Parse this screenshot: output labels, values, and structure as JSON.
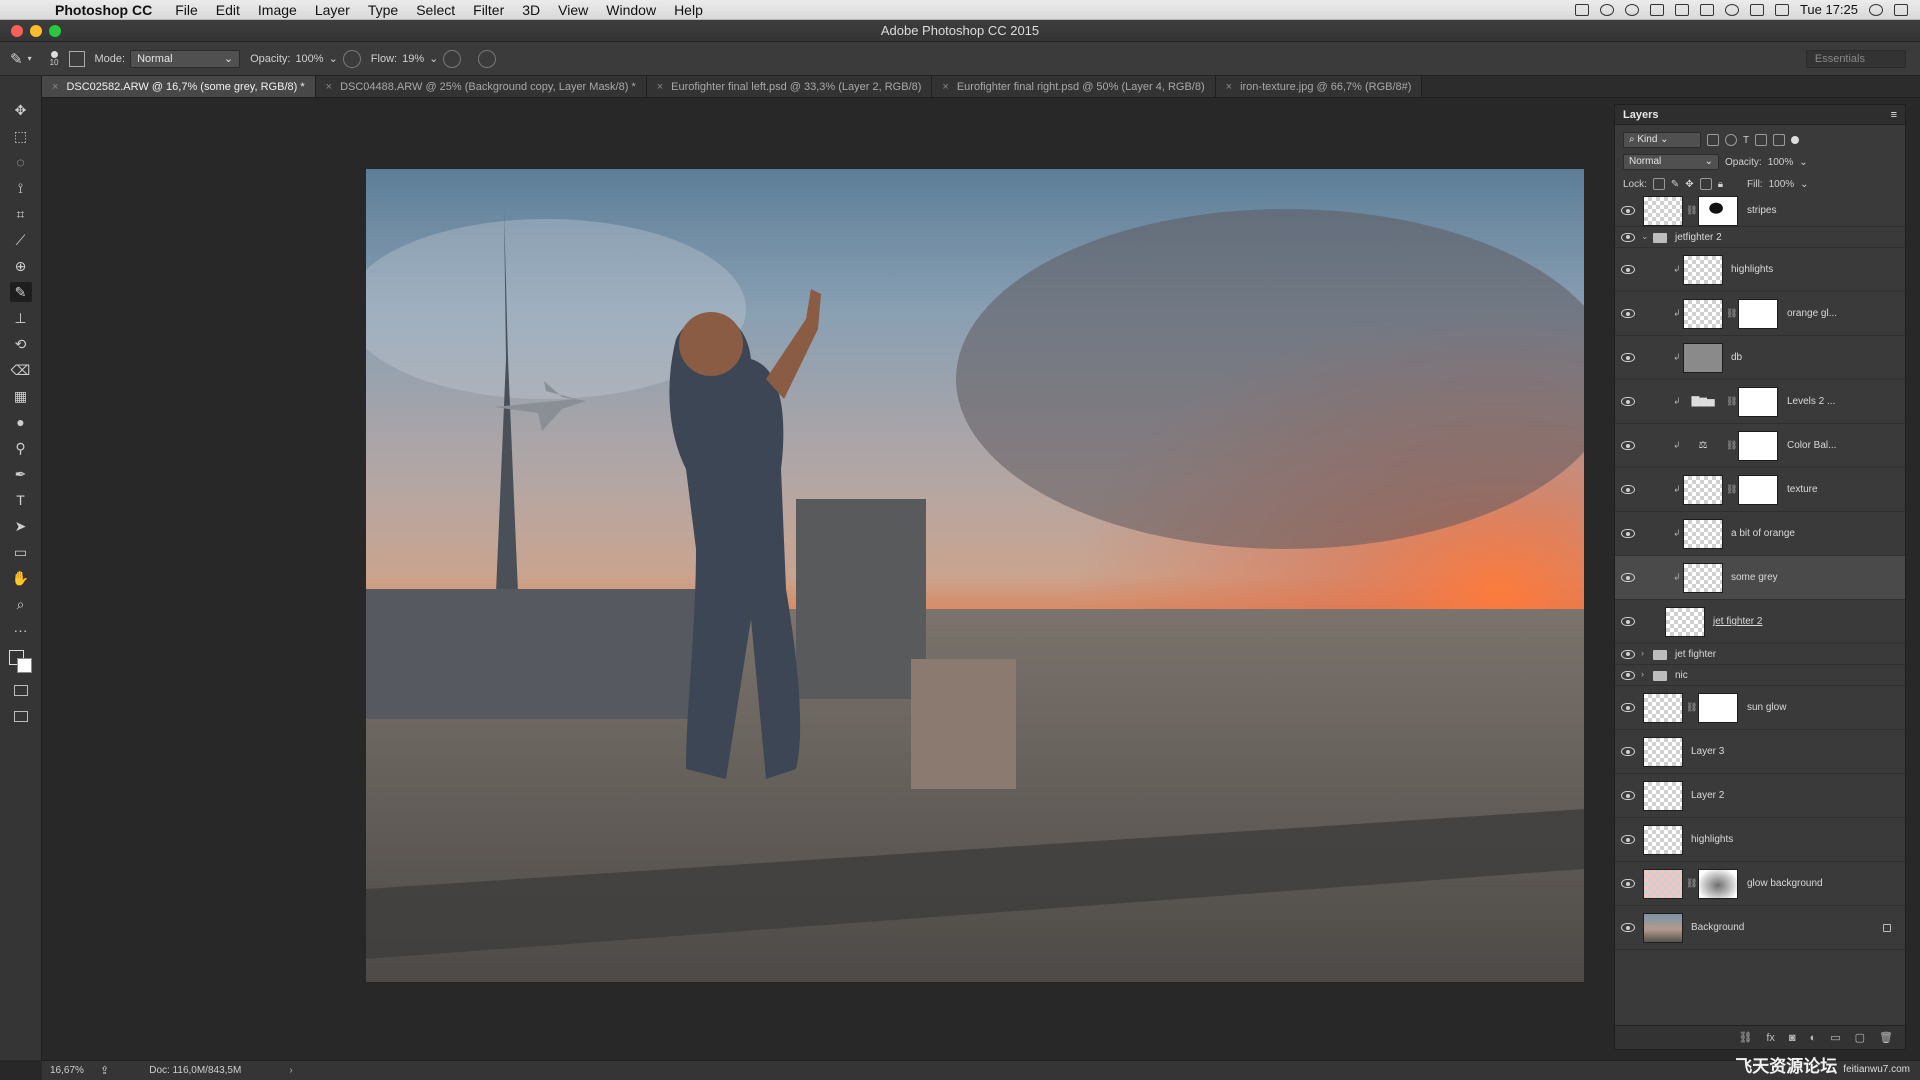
{
  "menubar": {
    "app_name": "Photoshop CC",
    "items": [
      "File",
      "Edit",
      "Image",
      "Layer",
      "Type",
      "Select",
      "Filter",
      "3D",
      "View",
      "Window",
      "Help"
    ],
    "clock": "Tue 17:25"
  },
  "window": {
    "title": "Adobe Photoshop CC 2015"
  },
  "options": {
    "brush_size": "10",
    "mode_label": "Mode:",
    "mode_value": "Normal",
    "opacity_label": "Opacity:",
    "opacity_value": "100%",
    "flow_label": "Flow:",
    "flow_value": "19%",
    "workspace": "Essentials"
  },
  "tabs": [
    {
      "label": "DSC02582.ARW @ 16,7% (some grey, RGB/8) *",
      "active": true
    },
    {
      "label": "DSC04488.ARW @ 25% (Background copy, Layer Mask/8) *",
      "active": false
    },
    {
      "label": "Eurofighter final left.psd @ 33,3% (Layer 2, RGB/8)",
      "active": false
    },
    {
      "label": "Eurofighter final right.psd @ 50% (Layer 4, RGB/8)",
      "active": false
    },
    {
      "label": "iron-texture.jpg @ 66,7% (RGB/8#)",
      "active": false
    }
  ],
  "tools": [
    "move-tool",
    "marquee-tool",
    "lasso-tool",
    "quick-select-tool",
    "crop-tool",
    "eyedropper-tool",
    "healing-tool",
    "brush-tool",
    "stamp-tool",
    "history-brush-tool",
    "eraser-tool",
    "gradient-tool",
    "blur-tool",
    "dodge-tool",
    "pen-tool",
    "type-tool",
    "path-select-tool",
    "shape-tool",
    "hand-tool",
    "zoom-tool",
    "more-tools"
  ],
  "tool_glyphs": [
    "✥",
    "⬚",
    "◌",
    "⟟",
    "⌗",
    "⟋",
    "⊕",
    "✎",
    "⊥",
    "⟲",
    "⌫",
    "▦",
    "●",
    "⚲",
    "✒",
    "T",
    "➤",
    "▭",
    "✋",
    "⌕",
    "···"
  ],
  "colors": {
    "foreground": "#333333",
    "background": "#ffffff",
    "accent": "#4a4a4a"
  },
  "layers_panel": {
    "title": "Layers",
    "filter_kind": "Kind",
    "blend_mode": "Normal",
    "opacity_label": "Opacity:",
    "opacity_value": "100%",
    "lock_label": "Lock:",
    "fill_label": "Fill:",
    "fill_value": "100%",
    "layers": [
      {
        "name": "stripes",
        "indent": 0,
        "kind": "masked",
        "mask": "brush"
      },
      {
        "name": "jetfighter 2",
        "indent": 0,
        "kind": "group",
        "open": true
      },
      {
        "name": "highlights",
        "indent": 1,
        "kind": "pixel",
        "clip": true
      },
      {
        "name": "orange gl...",
        "indent": 1,
        "kind": "masked",
        "clip": true
      },
      {
        "name": "db",
        "indent": 1,
        "kind": "solid",
        "clip": true
      },
      {
        "name": "Levels 2 ...",
        "indent": 1,
        "kind": "adjust",
        "glyph": "levels",
        "clip": true
      },
      {
        "name": "Color Bal...",
        "indent": 1,
        "kind": "adjust",
        "glyph": "balance",
        "clip": true
      },
      {
        "name": "texture",
        "indent": 1,
        "kind": "masked",
        "clip": true
      },
      {
        "name": "a bit of orange",
        "indent": 1,
        "kind": "pixel",
        "clip": true
      },
      {
        "name": "some grey",
        "indent": 1,
        "kind": "pixel",
        "clip": true,
        "selected": true
      },
      {
        "name": "jet fighter 2",
        "indent": 1,
        "kind": "pixel",
        "underline": true
      },
      {
        "name": "jet fighter",
        "indent": 0,
        "kind": "group",
        "open": false
      },
      {
        "name": "nic",
        "indent": 0,
        "kind": "group",
        "open": false
      },
      {
        "name": "sun glow",
        "indent": 0,
        "kind": "masked"
      },
      {
        "name": "Layer 3",
        "indent": 0,
        "kind": "pixel"
      },
      {
        "name": "Layer 2",
        "indent": 0,
        "kind": "pixel"
      },
      {
        "name": "highlights",
        "indent": 0,
        "kind": "pixel"
      },
      {
        "name": "glow background",
        "indent": 0,
        "kind": "masked",
        "mask": "cloud",
        "tint": "pink"
      },
      {
        "name": "Background",
        "indent": 0,
        "kind": "image",
        "locked": true
      }
    ],
    "footer_icons": [
      "link-icon",
      "fx-icon",
      "mask-icon",
      "adjustment-icon",
      "folder-icon",
      "new-layer-icon",
      "trash-icon"
    ],
    "footer_glyphs": [
      "⛓",
      "fx",
      "◙",
      "◐",
      "▭",
      "▢",
      "🗑"
    ]
  },
  "status": {
    "zoom": "16,67%",
    "doc": "Doc: 116,0M/843,5M"
  },
  "watermark": {
    "text": "飞天资源论坛",
    "domain": "feitianwu7.com"
  }
}
